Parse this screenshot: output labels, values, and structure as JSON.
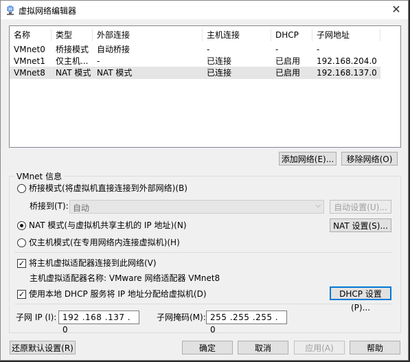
{
  "window": {
    "title": "虚拟网络编辑器",
    "close": "✕"
  },
  "list": {
    "headers": [
      "名称",
      "类型",
      "外部连接",
      "主机连接",
      "DHCP",
      "子网地址"
    ],
    "rows": [
      [
        "VMnet0",
        "桥接模式",
        "自动桥接",
        "-",
        "-",
        "-"
      ],
      [
        "VMnet1",
        "仅主机...",
        "-",
        "已连接",
        "已启用",
        "192.168.204.0"
      ],
      [
        "VMnet8",
        "NAT 模式",
        "NAT 模式",
        "已连接",
        "已启用",
        "192.168.137.0"
      ]
    ],
    "selected_row": 2
  },
  "buttons": {
    "add_network": "添加网络(E)...",
    "remove_network": "移除网络(O)"
  },
  "vmnet_info": {
    "group_label": "VMnet 信息",
    "bridged_radio": "桥接模式(将虚拟机直接连接到外部网络)(B)",
    "bridged_to_label": "桥接到(T):",
    "bridged_to_value": "自动",
    "auto_settings": "自动设置(U)...",
    "nat_radio": "NAT 模式(与虚拟机共享主机的 IP 地址)(N)",
    "nat_settings": "NAT 设置(S)...",
    "hostonly_radio": "仅主机模式(在专用网络内连接虚拟机)(H)",
    "connect_adapter_check": "将主机虚拟适配器连接到此网络(V)",
    "adapter_name": "主机虚拟适配器名称: VMware 网络适配器 VMnet8",
    "dhcp_check": "使用本地 DHCP 服务将 IP 地址分配给虚拟机(D)",
    "dhcp_settings": "DHCP 设置(P)...",
    "subnet_ip_label": "子网 IP (I):",
    "subnet_ip_value": "192 .168 .137 . 0",
    "subnet_mask_label": "子网掩码(M):",
    "subnet_mask_value": "255 .255 .255 . 0",
    "selected_mode": "nat",
    "connect_adapter_checked": true,
    "dhcp_checked": true
  },
  "footer": {
    "restore_defaults": "还原默认设置(R)",
    "ok": "确定",
    "cancel": "取消",
    "apply": "应用(A)",
    "help": "帮助"
  }
}
